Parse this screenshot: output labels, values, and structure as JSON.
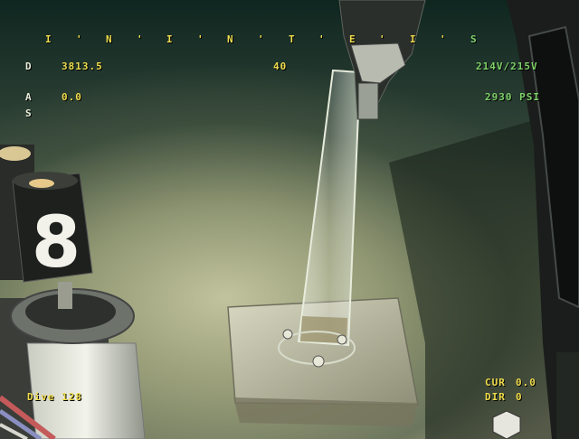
{
  "hud": {
    "heading_scale": [
      "I",
      "'",
      "N",
      "'",
      "I",
      "'",
      "N",
      "'",
      "T",
      "'",
      "E",
      "'",
      "I",
      "'",
      "S"
    ],
    "depth_label": "D",
    "depth_value": "3813.5",
    "mid_value": "40",
    "voltage": "214V/215V",
    "altitude_label": "A",
    "altitude_value": "0.0",
    "pressure": "2930 PSI",
    "s_label": "S",
    "dive": "Dive 128",
    "cur_label": "CUR",
    "cur_value": "0.0",
    "dir_label": "DIR",
    "dir_value": "0"
  },
  "scene": {
    "marker_number": "8"
  },
  "colors": {
    "hud_white": "#e9eeda",
    "hud_yellow": "#f0dd4e",
    "hud_green": "#7fd26a",
    "seafloor": "#a7a788"
  }
}
